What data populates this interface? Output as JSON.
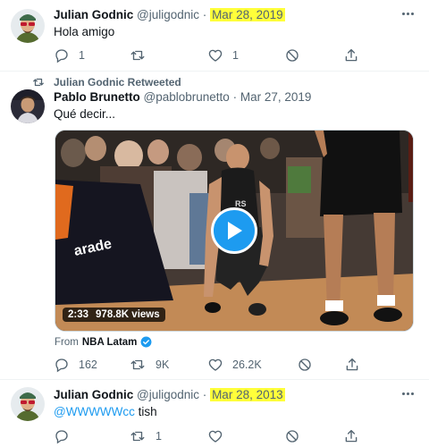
{
  "tweets": [
    {
      "name": "Julian Godnic",
      "handle": "@juligodnic",
      "separator": "·",
      "date": "Mar 28, 2019",
      "text": "Hola amigo",
      "replies": "1",
      "retweets": "",
      "likes": "1"
    },
    {
      "retweeted_by": "Julian Godnic Retweeted",
      "name": "Pablo Brunetto",
      "handle": "@pablobrunetto",
      "separator": "·",
      "date": "Mar 27, 2019",
      "text": "Qué decir...",
      "video": {
        "duration": "2:33",
        "views": "978.8K views"
      },
      "from_label": "From",
      "from_account": "NBA Latam",
      "replies": "162",
      "retweets": "9K",
      "likes": "26.2K"
    },
    {
      "name": "Julian Godnic",
      "handle": "@juligodnic",
      "separator": "·",
      "date": "Mar 28, 2013",
      "mention": "@WWWWWcc",
      "text": " tish",
      "replies": "",
      "retweets": "1",
      "likes": ""
    }
  ],
  "colors": {
    "highlight": "#ffff3a",
    "accent": "#1d9bf0",
    "muted": "#536471"
  },
  "icons": [
    "avatar",
    "more-icon",
    "reply-icon",
    "retweet-icon",
    "like-icon",
    "block-icon",
    "share-icon",
    "play-icon",
    "verified-icon"
  ]
}
